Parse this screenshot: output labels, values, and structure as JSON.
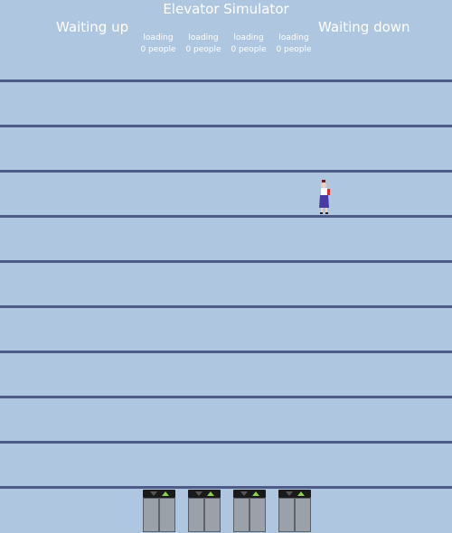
{
  "title": "Elevator Simulator",
  "waiting_up_label": "Waiting up",
  "waiting_down_label": "Waiting down",
  "elevators": [
    {
      "state": "loading",
      "occupancy": "0 people",
      "up_indicator_color": "#8cd346",
      "down_indicator_color": "#555555"
    },
    {
      "state": "loading",
      "occupancy": "0 people",
      "up_indicator_color": "#8cd346",
      "down_indicator_color": "#555555"
    },
    {
      "state": "loading",
      "occupancy": "0 people",
      "up_indicator_color": "#8cd346",
      "down_indicator_color": "#555555"
    },
    {
      "state": "loading",
      "occupancy": "0 people",
      "up_indicator_color": "#8cd346",
      "down_indicator_color": "#555555"
    }
  ],
  "colors": {
    "background": "#afc6e0",
    "floor_line": "#4e5a88",
    "text": "#ffffff"
  }
}
